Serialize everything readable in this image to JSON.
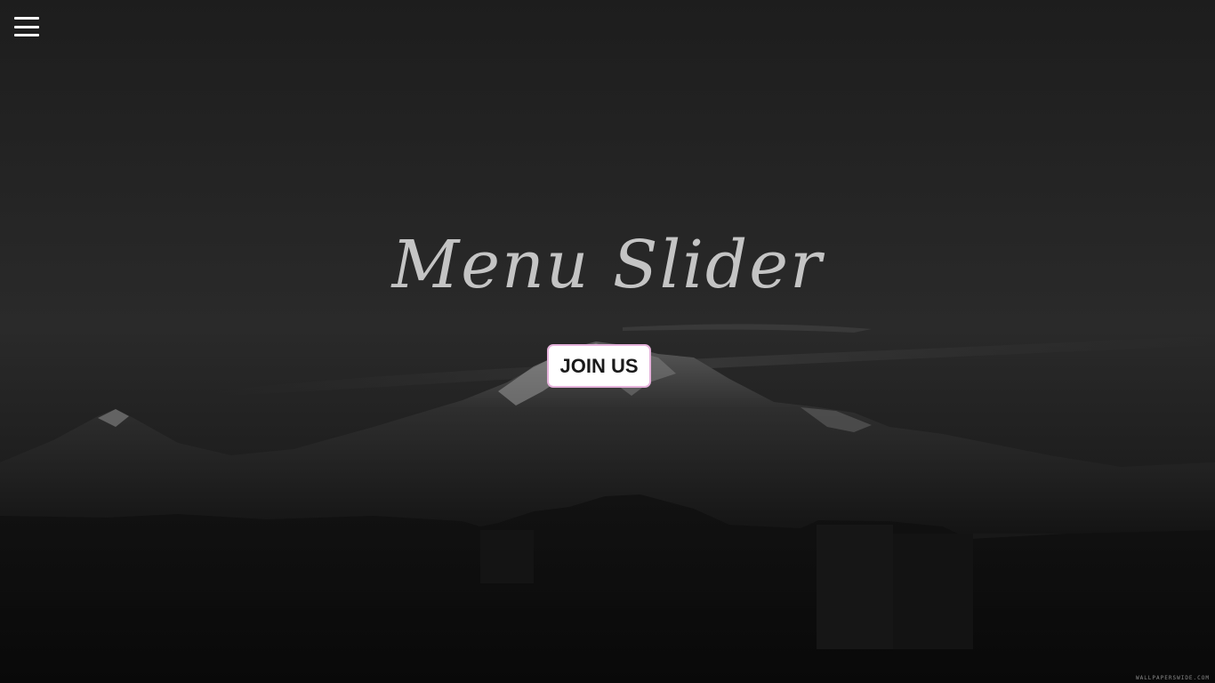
{
  "page": {
    "title": "Menu Slider",
    "menu_icon": "hamburger-menu-icon"
  },
  "hero": {
    "cta_label": "JOIN US",
    "watermark": "WALLPAPERSWIDE.COM"
  },
  "colors": {
    "title": "#c4c4c4",
    "button_bg": "#ffffff",
    "button_border": "#e6b3dc",
    "button_text": "#1a1a1a",
    "menu_icon": "#ffffff"
  }
}
